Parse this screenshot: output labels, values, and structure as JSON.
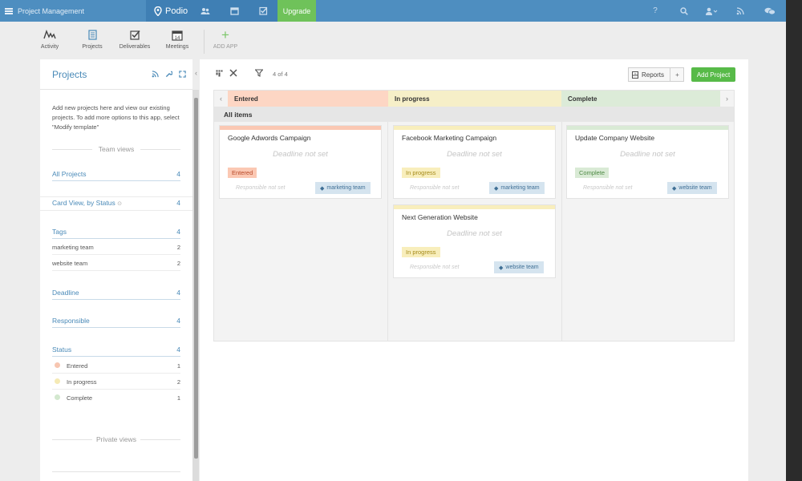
{
  "topbar": {
    "workspace": "Project Management",
    "brand": "Podio",
    "upgrade": "Upgrade",
    "help": "?"
  },
  "apps": [
    {
      "label": "Activity",
      "icon": "activity-icon"
    },
    {
      "label": "Projects",
      "icon": "projects-icon"
    },
    {
      "label": "Deliverables",
      "icon": "deliverables-icon"
    },
    {
      "label": "Meetings",
      "icon": "calendar-icon",
      "day": "14"
    },
    {
      "label": "ADD APP",
      "icon": "plus-icon"
    }
  ],
  "sidebar": {
    "title": "Projects",
    "description": "Add new projects here and view our existing projects. To add more options to this app, select \"Modify template\"",
    "team_views_label": "Team views",
    "views": [
      {
        "label": "All Projects",
        "count": "4"
      },
      {
        "label": "Card View, by Status",
        "count": "4"
      }
    ],
    "tags": {
      "label": "Tags",
      "count": "4",
      "items": [
        {
          "label": "marketing team",
          "count": "2"
        },
        {
          "label": "website team",
          "count": "2"
        }
      ]
    },
    "deadline": {
      "label": "Deadline",
      "count": "4"
    },
    "responsible": {
      "label": "Responsible",
      "count": "4"
    },
    "status": {
      "label": "Status",
      "count": "4",
      "items": [
        {
          "label": "Entered",
          "count": "1",
          "color": "#f7c6b1"
        },
        {
          "label": "In progress",
          "count": "2",
          "color": "#f5eab5"
        },
        {
          "label": "Complete",
          "count": "1",
          "color": "#d3e8cf"
        }
      ]
    },
    "private_views_label": "Private views"
  },
  "toolbar": {
    "filter_count": "4 of 4",
    "reports": "Reports",
    "plus": "+",
    "add_project": "Add Project"
  },
  "board": {
    "group_label": "All items",
    "columns": [
      {
        "label": "Entered",
        "color": "#fdd6c4"
      },
      {
        "label": "In progress",
        "color": "#f6efc8"
      },
      {
        "label": "Complete",
        "color": "#dcebd8"
      }
    ],
    "cards": [
      {
        "title": "Google Adwords Campaign",
        "deadline": "Deadline not set",
        "status": "Entered",
        "responsible": "Responsible not set",
        "tag": "marketing team"
      },
      {
        "title": "Facebook Marketing Campaign",
        "deadline": "Deadline not set",
        "status": "In progress",
        "responsible": "Responsible not set",
        "tag": "marketing team"
      },
      {
        "title": "Next Generation Website",
        "deadline": "Deadline not set",
        "status": "In progress",
        "responsible": "Responsible not set",
        "tag": "website team"
      },
      {
        "title": "Update Company Website",
        "deadline": "Deadline not set",
        "status": "Complete",
        "responsible": "Responsible not set",
        "tag": "website team"
      }
    ]
  },
  "colors": {
    "topbar": "#4e8ec0",
    "accent_blue": "#4a8ab8",
    "green": "#57ba48",
    "entered_badge": "#fbc8b3",
    "entered_text": "#b84a2a",
    "progress_badge": "#f8eebc",
    "progress_text": "#a58a1a",
    "complete_badge": "#d9ead5",
    "complete_text": "#4f8a45"
  }
}
